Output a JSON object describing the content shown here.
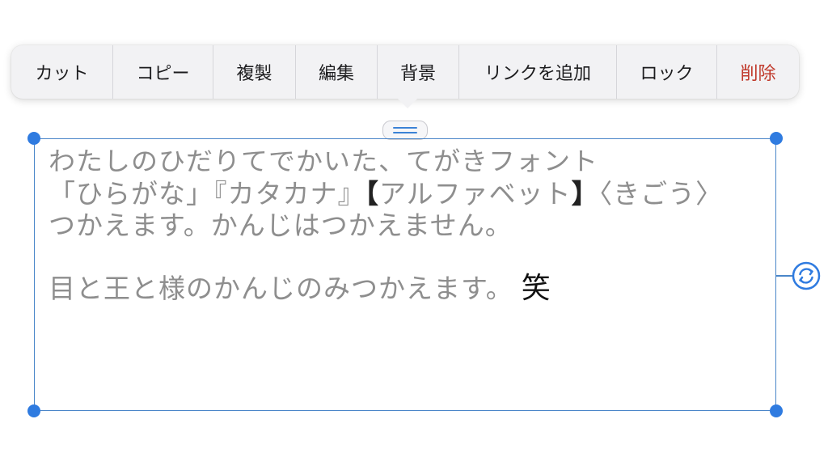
{
  "menu": {
    "items": [
      {
        "label": "カット",
        "width": 126
      },
      {
        "label": "コピー",
        "width": 124
      },
      {
        "label": "複製",
        "width": 102
      },
      {
        "label": "編集",
        "width": 101
      },
      {
        "label": "背景",
        "width": 101
      },
      {
        "label": "リンクを追加",
        "width": 195
      },
      {
        "label": "ロック",
        "width": 124
      },
      {
        "label": "削除",
        "width": 101
      }
    ],
    "destructive_color": "#c0392b"
  },
  "textbox": {
    "line1": "わたしのひだりてでかいた、てがきフォント",
    "line2_a": "「ひらがな」『カタカナ』",
    "line2_open": "【",
    "line2_b": "アルファベット",
    "line2_close": "】",
    "line2_c": "〈きごう〉",
    "line3": "つかえます。かんじはつかえません。",
    "line4": "目と王と様のかんじのみつかえます。",
    "line4_emoji": "笑"
  },
  "icons": {
    "drag": "drag-handle-icon",
    "rotate": "rotate-icon"
  },
  "colors": {
    "selection": "#2f7be0",
    "handwriting": "#8e8e8e"
  }
}
